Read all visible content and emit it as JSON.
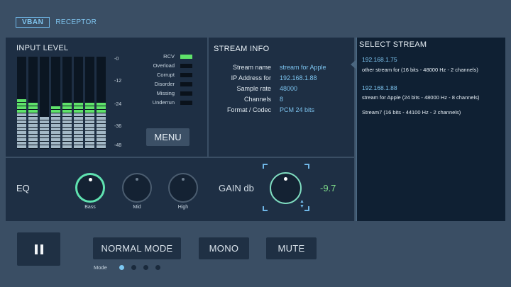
{
  "brand": {
    "vban": "VBAN",
    "receptor": "RECEPTOR"
  },
  "input_level": {
    "title": "INPUT LEVEL",
    "scale": [
      "-0",
      "-12",
      "-24",
      "-36",
      "-48"
    ],
    "channels": [
      {
        "green": 4,
        "light": 10
      },
      {
        "green": 3,
        "light": 10
      },
      {
        "green": 0,
        "light": 9
      },
      {
        "green": 2,
        "light": 10
      },
      {
        "green": 3,
        "light": 10
      },
      {
        "green": 3,
        "light": 10
      },
      {
        "green": 3,
        "light": 10
      },
      {
        "green": 3,
        "light": 10
      }
    ],
    "status": [
      {
        "label": "RCV",
        "on": true
      },
      {
        "label": "Overload",
        "on": false
      },
      {
        "label": "Corrupt",
        "on": false
      },
      {
        "label": "Disorder",
        "on": false
      },
      {
        "label": "Missing",
        "on": false
      },
      {
        "label": "Underrun",
        "on": false
      }
    ],
    "menu_label": "MENU"
  },
  "stream_info": {
    "title": "STREAM INFO",
    "rows": [
      {
        "key": "Stream name",
        "value": "stream for Apple"
      },
      {
        "key": "IP Address for",
        "value": "192.168.1.88"
      },
      {
        "key": "Sample rate",
        "value": "48000"
      },
      {
        "key": "Channels",
        "value": "8"
      },
      {
        "key": "Format / Codec",
        "value": "PCM 24 bits"
      }
    ]
  },
  "eq": {
    "label": "EQ",
    "knobs": [
      {
        "label": "Bass",
        "value": 0.5,
        "active": true
      },
      {
        "label": "Mid",
        "value": 0.5,
        "active": false
      },
      {
        "label": "High",
        "value": 0.5,
        "active": false
      }
    ],
    "gain_label": "GAIN db",
    "gain_value": "-9.7"
  },
  "select_stream": {
    "title": "SELECT STREAM",
    "items": [
      {
        "ip": "192.168.1.75",
        "desc": "other stream for (16 bits - 48000 Hz - 2 channels)"
      },
      {
        "ip": "192.168.1.88",
        "desc": "stream for Apple (24 bits - 48000 Hz - 8 channels)"
      },
      {
        "ip": "",
        "desc": "Stream7 (16 bits - 44100 Hz - 2 channels)"
      }
    ]
  },
  "controls": {
    "normal_mode": "NORMAL MODE",
    "mono": "MONO",
    "mute": "MUTE",
    "mode_label": "Mode",
    "mode_selected": 0,
    "mode_count": 4
  },
  "colors": {
    "accent": "#7cc3ee",
    "meter_green": "#5fe26a",
    "gain_green": "#7fdc8a"
  }
}
